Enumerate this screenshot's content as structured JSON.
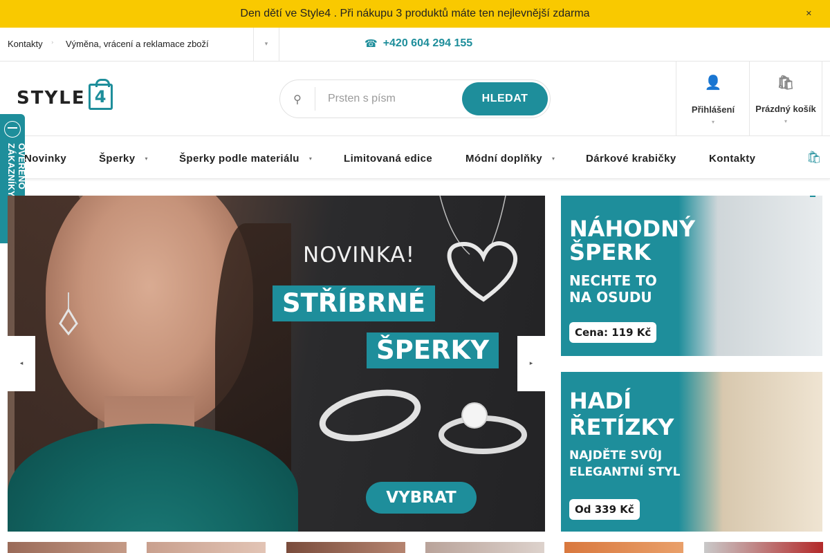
{
  "announcement": {
    "text": " Den dětí ve Style4 . Při nákupu 3 produktů máte ten nejlevnější zdarma ",
    "close_icon": "close-icon"
  },
  "utility": {
    "links": [
      "Kontakty",
      "Výměna, vrácení a reklamace zboží"
    ],
    "phone": "+420 604 294 155"
  },
  "header": {
    "logo_text": "STYLE",
    "logo_digit": "4",
    "search": {
      "placeholder": "Prsten s písm",
      "button": "HLEDAT"
    },
    "login_label": "Přihlášení",
    "cart_label": "Prázdný košík"
  },
  "nav": {
    "items": [
      {
        "label": "Novinky"
      },
      {
        "label": "Šperky"
      },
      {
        "label": "Šperky podle materiálu"
      },
      {
        "label": "Limitovaná edice"
      },
      {
        "label": "Módní doplňky"
      },
      {
        "label": "Dárkové krabičky"
      },
      {
        "label": "Kontakty"
      }
    ]
  },
  "badge": {
    "text": "OVĚŘENO ZÁKAZNÍKY"
  },
  "hero": {
    "line1": "NOVINKA!",
    "line2": "STŘÍBRNÉ",
    "line3": "ŠPERKY",
    "cta": "VYBRAT"
  },
  "banners": [
    {
      "title1": "NÁHODNÝ",
      "title2": "ŠPERK",
      "sub1": "NECHTE TO",
      "sub2": "NA OSUDU",
      "price": "Cena: 119 Kč"
    },
    {
      "title1": "HADÍ",
      "title2": "ŘETÍZKY",
      "sub1": "NAJDĚTE SVŮJ",
      "sub2": "ELEGANTNÍ STYL",
      "price": "Od 339 Kč"
    }
  ],
  "colors": {
    "accent": "#1e8e9b",
    "announcement_bg": "#f9c900"
  }
}
